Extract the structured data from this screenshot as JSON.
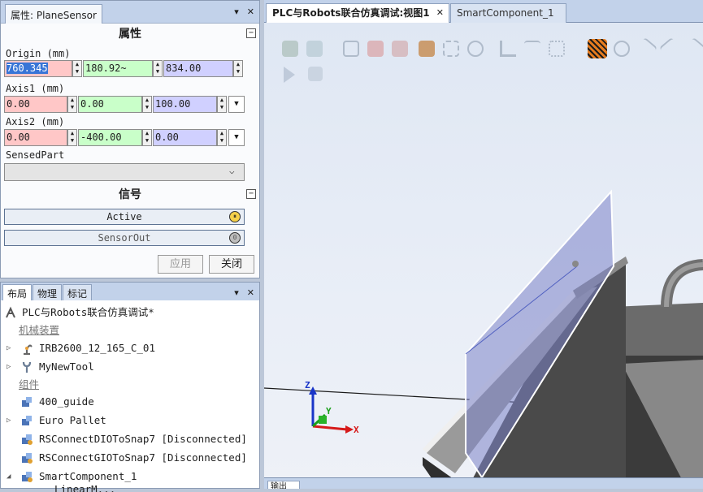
{
  "props_panel": {
    "title": "属性: PlaneSensor",
    "pin": "▾",
    "close": "✕",
    "section_props": "属性",
    "section_signals": "信号",
    "collapse_glyph": "−",
    "origin": {
      "label": "Origin (mm)",
      "x": "760.345",
      "y": "180.92~",
      "z": "834.00"
    },
    "axis1": {
      "label": "Axis1 (mm)",
      "x": "0.00",
      "y": "0.00",
      "z": "100.00"
    },
    "axis2": {
      "label": "Axis2 (mm)",
      "x": "0.00",
      "y": "-400.00",
      "z": "0.00"
    },
    "sensed_part": {
      "label": "SensedPart",
      "value": ""
    },
    "signals": [
      {
        "label": "Active"
      },
      {
        "label": "SensorOut"
      }
    ],
    "apply": "应用",
    "close_btn": "关闭"
  },
  "layout_panel": {
    "tabs": [
      "布局",
      "物理",
      "标记"
    ],
    "pin": "▾",
    "close": "✕",
    "root": "PLC与Robots联合仿真调试*",
    "cat_mech": "机械装置",
    "robot": "IRB2600_12_165_C_01",
    "tool": "MyNewTool",
    "cat_comp": "组件",
    "items": [
      "400_guide",
      "Euro Pallet",
      "RSConnectDIOToSnap7 [Disconnected]",
      "RSConnectGIOToSnap7 [Disconnected]",
      "SmartComponent_1",
      "LinearM..."
    ]
  },
  "view": {
    "tab1": "PLC与Robots联合仿真调试:视图1",
    "tab1_close": "✕",
    "tab2": "SmartComponent_1",
    "axis_x": "X",
    "axis_y": "Y",
    "axis_z": "Z",
    "bottom_tab": "输出"
  },
  "colors": {
    "accent": "#c2d2ea",
    "red_field": "#ffc7c7",
    "green_field": "#c9ffc9",
    "blue_field": "#d0d0ff"
  }
}
